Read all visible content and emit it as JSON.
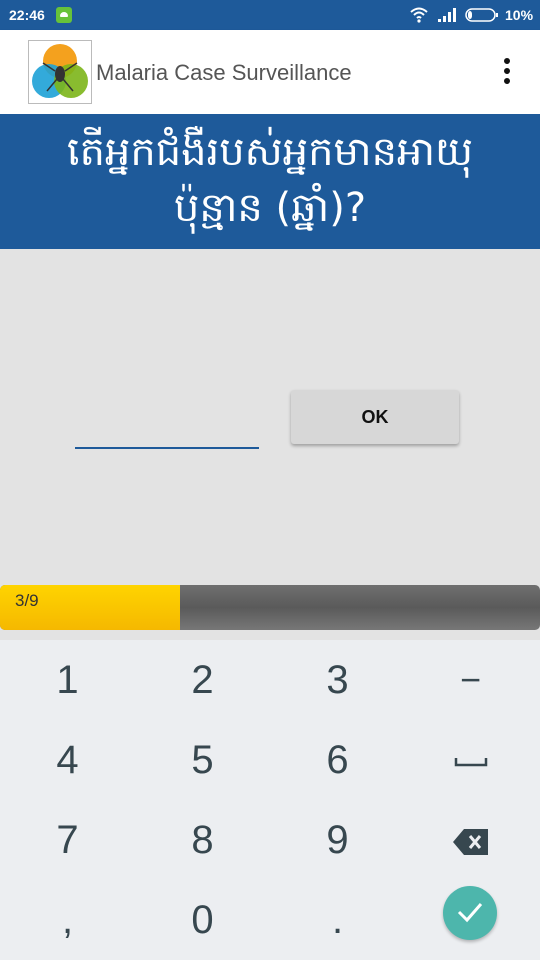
{
  "status_bar": {
    "time": "22:46",
    "battery": "10%"
  },
  "app_bar": {
    "title": "Malaria Case Surveillance"
  },
  "question": {
    "text": "តើអ្នកជំងឺរបស់អ្នកមានអាយុ ប៉ុន្មាន (ឆ្នាំ)?"
  },
  "answer": {
    "value": "",
    "placeholder": ""
  },
  "ok_label": "OK",
  "progress": {
    "label": "3/9",
    "current": 3,
    "total": 9
  },
  "keypad": {
    "keys": [
      "1",
      "2",
      "3",
      "−",
      "4",
      "5",
      "6",
      "␣",
      "7",
      "8",
      "9",
      "⌫",
      ",",
      "0",
      "."
    ],
    "space_label": "␣",
    "backspace_icon": "backspace-icon",
    "done_icon": "check-icon"
  },
  "colors": {
    "brand_blue": "#1e5a9a",
    "progress_fill": "#ffcc00",
    "done_button": "#4db6ac"
  }
}
